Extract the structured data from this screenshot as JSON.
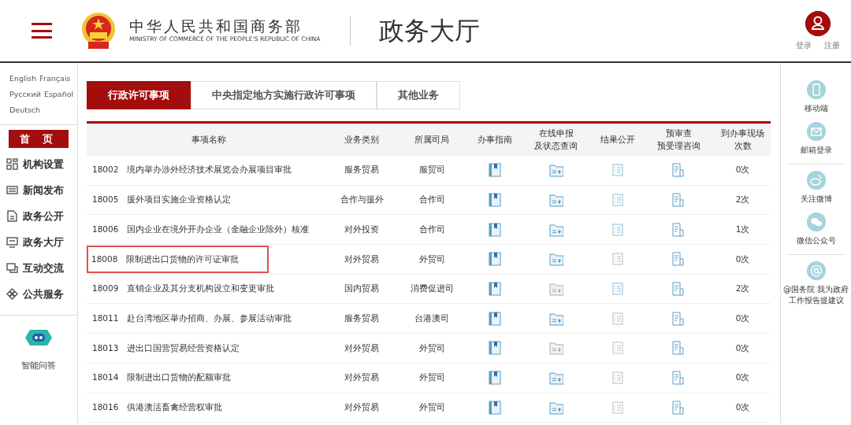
{
  "header": {
    "ministry_name": "中华人民共和国商务部",
    "ministry_name_en": "MINISTRY OF COMMERCE OF THE PEOPLE'S REPUBLIC OF CHINA",
    "section_title": "政务大厅",
    "login": "登录",
    "register": "注册"
  },
  "languages": [
    "English",
    "Français",
    "Русский",
    "Español",
    "Deutsch"
  ],
  "sidebar": {
    "items": [
      {
        "label": "首 页",
        "selected": true
      },
      {
        "label": "机构设置",
        "selected": false
      },
      {
        "label": "新闻发布",
        "selected": false
      },
      {
        "label": "政务公开",
        "selected": false
      },
      {
        "label": "政务大厅",
        "selected": false
      },
      {
        "label": "互动交流",
        "selected": false
      },
      {
        "label": "公共服务",
        "selected": false
      }
    ],
    "assistant": "智能问答"
  },
  "tabs": [
    {
      "label": "行政许可事项",
      "selected": true
    },
    {
      "label": "中央指定地方实施行政许可事项",
      "selected": false
    },
    {
      "label": "其他业务",
      "selected": false
    }
  ],
  "table": {
    "columns": [
      [
        "事项名称"
      ],
      [
        "业务类别"
      ],
      [
        "所属司局"
      ],
      [
        "办事指南"
      ],
      [
        "在线申报",
        "及状态查询"
      ],
      [
        "结果公开"
      ],
      [
        "预审查",
        "预受理咨询"
      ],
      [
        "到办事现场",
        "次数"
      ]
    ],
    "rows": [
      {
        "code": "18002",
        "name": "境内举办涉外经济技术展览会办展项目审批",
        "category": "服务贸易",
        "department": "服贸司",
        "online_active": true,
        "results_active": true,
        "highlighted": false,
        "visits": "0次"
      },
      {
        "code": "18005",
        "name": "援外项目实施企业资格认定",
        "category": "合作与援外",
        "department": "合作司",
        "online_active": true,
        "results_active": true,
        "highlighted": false,
        "visits": "2次"
      },
      {
        "code": "18006",
        "name": "国内企业在境外开办企业（金融企业除外）核准",
        "category": "对外投资",
        "department": "合作司",
        "online_active": true,
        "results_active": true,
        "highlighted": false,
        "visits": "1次"
      },
      {
        "code": "18008",
        "name": "限制进出口货物的许可证审批",
        "category": "对外贸易",
        "department": "外贸司",
        "online_active": true,
        "results_active": false,
        "highlighted": true,
        "visits": "0次"
      },
      {
        "code": "18009",
        "name": "直销企业及其分支机构设立和变更审批",
        "category": "国内贸易",
        "department": "消费促进司",
        "online_active": false,
        "results_active": true,
        "highlighted": false,
        "visits": "2次"
      },
      {
        "code": "18011",
        "name": "赴台湾地区举办招商、办展、参展活动审批",
        "category": "服务贸易",
        "department": "台港澳司",
        "online_active": true,
        "results_active": false,
        "highlighted": false,
        "visits": "0次"
      },
      {
        "code": "18013",
        "name": "进出口国营贸易经营资格认定",
        "category": "对外贸易",
        "department": "外贸司",
        "online_active": false,
        "results_active": false,
        "highlighted": false,
        "visits": "0次"
      },
      {
        "code": "18014",
        "name": "限制进出口货物的配额审批",
        "category": "对外贸易",
        "department": "外贸司",
        "online_active": true,
        "results_active": false,
        "highlighted": false,
        "visits": "0次"
      },
      {
        "code": "18016",
        "name": "供港澳活畜禽经营权审批",
        "category": "对外贸易",
        "department": "外贸司",
        "online_active": true,
        "results_active": false,
        "highlighted": false,
        "visits": "0次"
      }
    ]
  },
  "right_sidebar": {
    "groups": [
      [
        {
          "label": "移动端"
        },
        {
          "label": "邮箱登录"
        }
      ],
      [
        {
          "label": "关注微博"
        },
        {
          "label": "微信公众号"
        }
      ],
      [
        {
          "label": "@国务院 我为政府工作报告提建议"
        }
      ]
    ]
  }
}
